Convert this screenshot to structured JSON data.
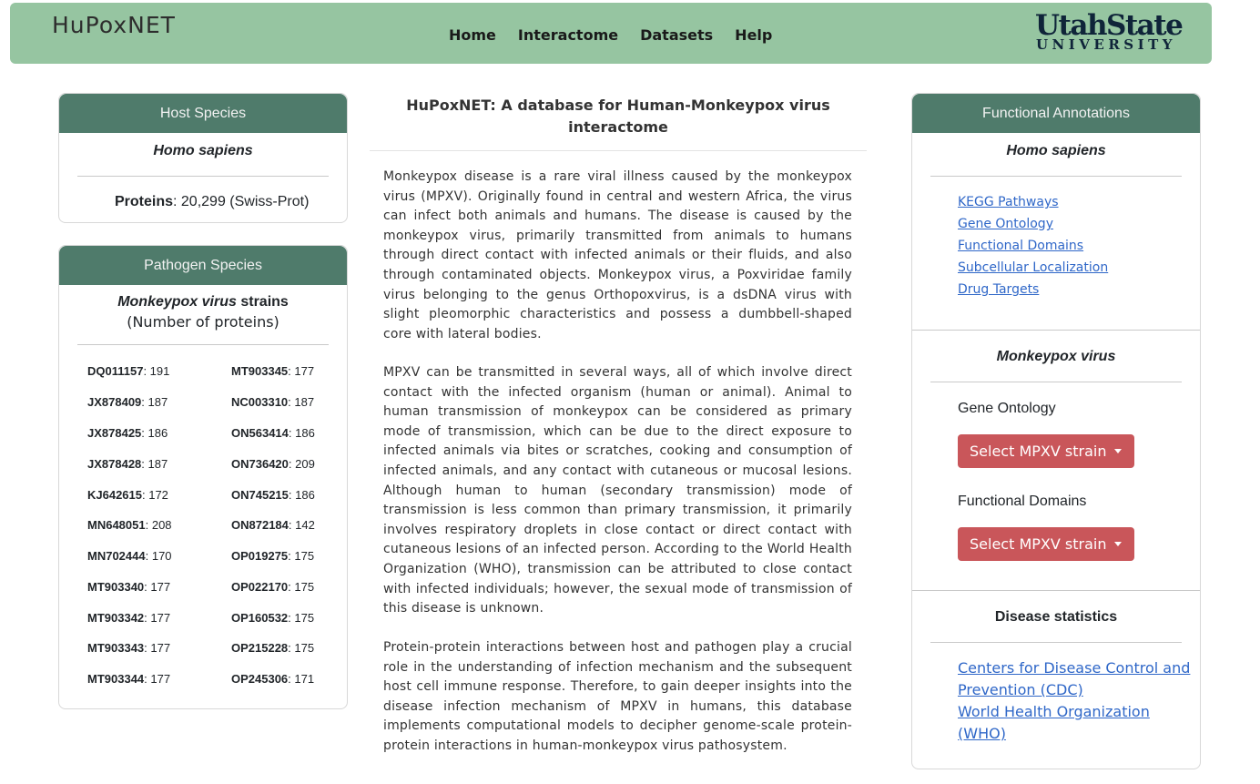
{
  "navbar": {
    "brand": "HuPoxNET",
    "links": [
      "Home",
      "Interactome",
      "Datasets",
      "Help"
    ],
    "logo_top": "UtahState",
    "logo_bottom": "UNIVERSITY"
  },
  "host": {
    "header": "Host Species",
    "species": "Homo sapiens",
    "proteins_label": "Proteins",
    "proteins_value": ": 20,299 (Swiss-Prot)"
  },
  "pathogen": {
    "header": "Pathogen Species",
    "species": "Monkeypox virus",
    "species_suffix": " strains",
    "subtitle": "(Number of proteins)",
    "strains_left": [
      {
        "id": "DQ011157",
        "count": ": 191"
      },
      {
        "id": "JX878409",
        "count": ": 187"
      },
      {
        "id": "JX878425",
        "count": ": 186"
      },
      {
        "id": "JX878428",
        "count": ": 187"
      },
      {
        "id": "KJ642615",
        "count": ": 172"
      },
      {
        "id": "MN648051",
        "count": ": 208"
      },
      {
        "id": "MN702444",
        "count": ": 170"
      },
      {
        "id": "MT903340",
        "count": ": 177"
      },
      {
        "id": "MT903342",
        "count": ": 177"
      },
      {
        "id": "MT903343",
        "count": ": 177"
      },
      {
        "id": "MT903344",
        "count": ": 177"
      }
    ],
    "strains_right": [
      {
        "id": "MT903345",
        "count": ": 177"
      },
      {
        "id": "NC003310",
        "count": ": 187"
      },
      {
        "id": "ON563414",
        "count": ": 186"
      },
      {
        "id": "ON736420",
        "count": ": 209"
      },
      {
        "id": "ON745215",
        "count": ": 186"
      },
      {
        "id": "ON872184",
        "count": ": 142"
      },
      {
        "id": "OP019275",
        "count": ": 175"
      },
      {
        "id": "OP022170",
        "count": ": 175"
      },
      {
        "id": "OP160532",
        "count": ": 175"
      },
      {
        "id": "OP215228",
        "count": ": 175"
      },
      {
        "id": "OP245306",
        "count": ": 171"
      }
    ]
  },
  "main": {
    "title": "HuPoxNET: A database for Human-Monkeypox virus interactome",
    "paragraphs": [
      "Monkeypox disease is a rare viral illness caused by the monkeypox virus (MPXV). Originally found in central and western Africa, the virus can infect both animals and humans. The disease is caused by the monkeypox virus, primarily transmitted from animals to humans through direct contact with infected animals or their fluids, and also through contaminated objects. Monkeypox virus, a Poxviridae family virus belonging to the genus Orthopoxvirus, is a dsDNA virus with slight pleomorphic characteristics and possess a dumbbell-shaped core with lateral bodies.",
      "MPXV can be transmitted in several ways, all of which involve direct contact with the infected organism (human or animal). Animal to human transmission of monkeypox can be considered as primary mode of transmission, which can be due to the direct exposure to infected animals via bites or scratches, cooking and consumption of infected animals, and any contact with cutaneous or mucosal lesions. Although human to human (secondary transmission) mode of transmission is less common than primary transmission, it primarily involves respiratory droplets in close contact or direct contact with cutaneous lesions of an infected person. According to the World Health Organization (WHO), transmission can be attributed to close contact with infected individuals; however, the sexual mode of transmission of this disease is unknown.",
      "Protein-protein interactions between host and pathogen play a crucial role in the understanding of infection mechanism and the subsequent host cell immune response. Therefore, to gain deeper insights into the disease infection mechanism of MPXV in humans, this database implements computational models to decipher genome-scale protein-protein interactions in human-monkeypox virus pathosystem."
    ]
  },
  "functional": {
    "header": "Functional Annotations",
    "host_species": "Homo sapiens",
    "host_links": [
      "KEGG Pathways",
      "Gene Ontology",
      "Functional Domains",
      "Subcellular Localization",
      "Drug Targets"
    ],
    "virus_species": "Monkeypox virus",
    "gene_ontology_label": "Gene Ontology",
    "functional_domains_label": "Functional Domains",
    "dropdown_label": "Select MPXV strain",
    "stats_title": "Disease statistics",
    "stats_links": [
      "Centers for Disease Control and Prevention (CDC)",
      "World Health Organization (WHO)"
    ]
  },
  "colors": {
    "navbar": "#96c5a1",
    "card_header": "#4f7b6b",
    "dropdown": "#c9565a",
    "link": "#2f67c8"
  }
}
